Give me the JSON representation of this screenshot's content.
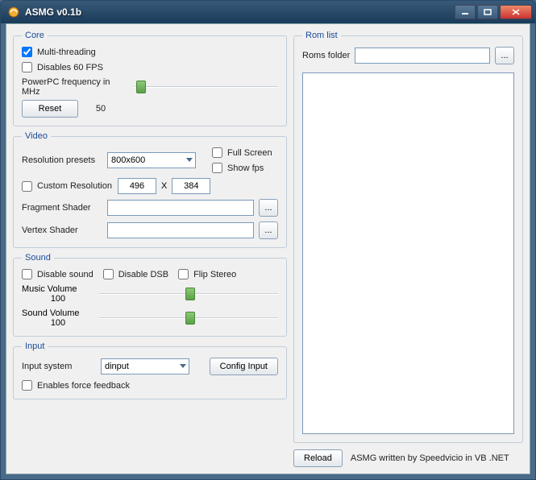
{
  "window": {
    "title": "ASMG v0.1b"
  },
  "core": {
    "legend": "Core",
    "multi_threading_label": "Multi-threading",
    "multi_threading_checked": true,
    "disables_60fps_label": "Disables 60 FPS",
    "disables_60fps_checked": false,
    "freq_label": "PowerPC frequency in MHz",
    "freq_value": "50",
    "reset_label": "Reset"
  },
  "video": {
    "legend": "Video",
    "res_presets_label": "Resolution presets",
    "res_preset_value": "800x600",
    "fullscreen_label": "Full Screen",
    "fullscreen_checked": false,
    "showfps_label": "Show fps",
    "showfps_checked": false,
    "custom_res_label": "Custom Resolution",
    "custom_res_checked": false,
    "custom_w": "496",
    "custom_sep": "X",
    "custom_h": "384",
    "frag_shader_label": "Fragment Shader",
    "frag_shader_value": "",
    "vert_shader_label": "Vertex Shader",
    "vert_shader_value": "",
    "browse_label": "..."
  },
  "sound": {
    "legend": "Sound",
    "disable_sound_label": "Disable sound",
    "disable_sound_checked": false,
    "disable_dsb_label": "Disable DSB",
    "disable_dsb_checked": false,
    "flip_stereo_label": "Flip Stereo",
    "flip_stereo_checked": false,
    "music_vol_label": "Music Volume",
    "music_vol_value": "100",
    "sound_vol_label": "Sound Volume",
    "sound_vol_value": "100"
  },
  "input": {
    "legend": "Input",
    "input_system_label": "Input system",
    "input_system_value": "dinput",
    "config_input_label": "Config Input",
    "force_feedback_label": "Enables force feedback",
    "force_feedback_checked": false
  },
  "romlist": {
    "legend": "Rom list",
    "folder_label": "Roms folder",
    "folder_value": "",
    "browse_label": "...",
    "reload_label": "Reload",
    "footer": "ASMG written by Speedvicio in VB .NET"
  }
}
